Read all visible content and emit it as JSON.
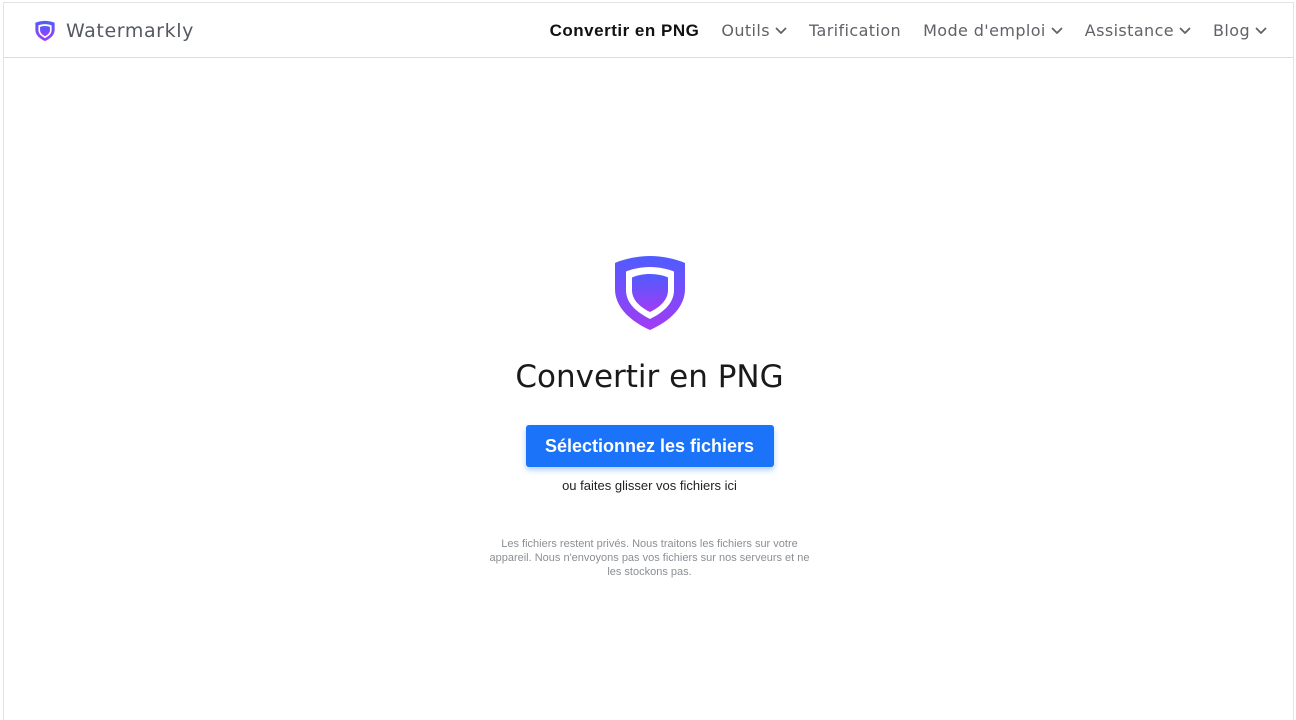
{
  "header": {
    "brand_name": "Watermarkly",
    "brand_icon": "shield-icon",
    "nav": [
      {
        "label": "Convertir en PNG",
        "active": true,
        "has_dropdown": false
      },
      {
        "label": "Outils",
        "active": false,
        "has_dropdown": true
      },
      {
        "label": "Tarification",
        "active": false,
        "has_dropdown": false
      },
      {
        "label": "Mode d'emploi",
        "active": false,
        "has_dropdown": true
      },
      {
        "label": "Assistance",
        "active": false,
        "has_dropdown": true
      },
      {
        "label": "Blog",
        "active": false,
        "has_dropdown": true
      }
    ]
  },
  "main": {
    "logo_icon": "shield-icon",
    "title": "Convertir en PNG",
    "select_button_label": "Sélectionnez les fichiers",
    "drop_hint": "ou faites glisser vos fichiers ici",
    "privacy_note": "Les fichiers restent privés. Nous traitons les fichiers sur votre appareil. Nous n'envoyons pas vos fichiers sur nos serveurs et ne les stockons pas."
  },
  "colors": {
    "accent": "#1a73f8",
    "shield_top": "#4f5cff",
    "shield_bottom": "#a13cf5"
  }
}
